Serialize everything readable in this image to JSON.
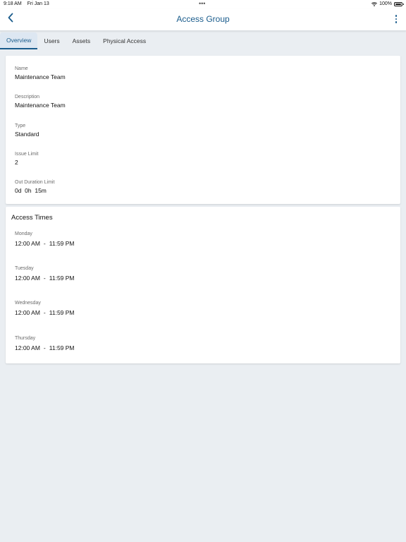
{
  "status_bar": {
    "time": "9:18 AM",
    "date": "Fri Jan 13",
    "battery": "100%"
  },
  "nav": {
    "title": "Access Group",
    "back_icon": "chevron-left-icon",
    "more_icon": "more-vertical-icon",
    "accent_color": "#1a5c8c"
  },
  "tabs": [
    {
      "label": "Overview",
      "active": true
    },
    {
      "label": "Users",
      "active": false
    },
    {
      "label": "Assets",
      "active": false
    },
    {
      "label": "Physical Access",
      "active": false
    }
  ],
  "overview": {
    "fields": [
      {
        "label": "Name",
        "value": "Maintenance Team"
      },
      {
        "label": "Description",
        "value": "Maintenance Team"
      },
      {
        "label": "Type",
        "value": "Standard"
      },
      {
        "label": "Issue Limit",
        "value": "2"
      },
      {
        "label": "Out Duration Limit",
        "value": "0d  0h  15m"
      }
    ]
  },
  "access_times": {
    "title": "Access Times",
    "separator": "-",
    "days": [
      {
        "day": "Monday",
        "start": "12:00 AM",
        "end": "11:59 PM"
      },
      {
        "day": "Tuesday",
        "start": "12:00 AM",
        "end": "11:59 PM"
      },
      {
        "day": "Wednesday",
        "start": "12:00 AM",
        "end": "11:59 PM"
      },
      {
        "day": "Thursday",
        "start": "12:00 AM",
        "end": "11:59 PM"
      }
    ]
  }
}
